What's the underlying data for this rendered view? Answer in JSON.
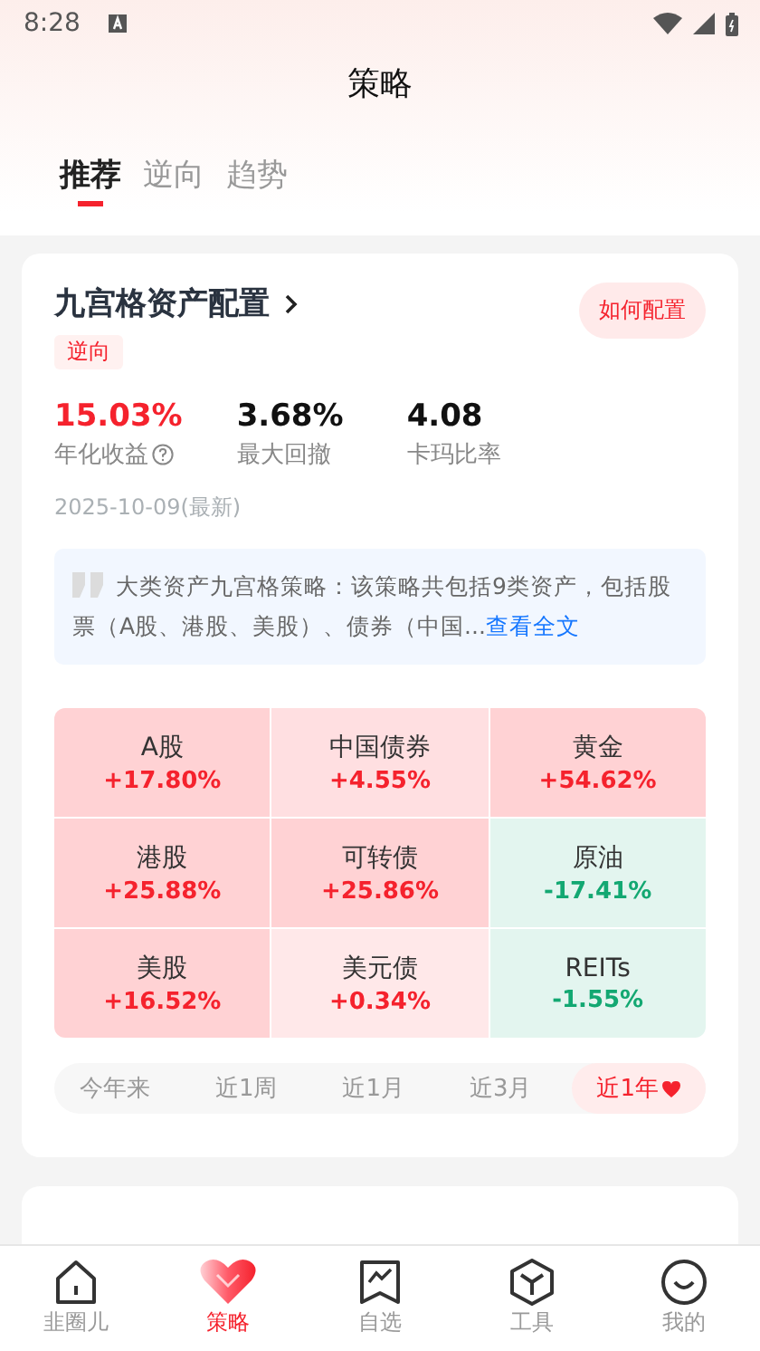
{
  "status_bar": {
    "time": "8:28"
  },
  "header": {
    "title": "策略"
  },
  "tabs": [
    {
      "label": "推荐",
      "selected": true
    },
    {
      "label": "逆向",
      "selected": false
    },
    {
      "label": "趋势",
      "selected": false
    }
  ],
  "strategy_card": {
    "title": "九宫格资产配置",
    "tag": "逆向",
    "action": "如何配置",
    "metrics": [
      {
        "value": "15.03%",
        "label": "年化收益",
        "kind": "highlight",
        "help": true
      },
      {
        "value": "3.68%",
        "label": "最大回撤",
        "kind": "normal",
        "help": false
      },
      {
        "value": "4.08",
        "label": "卡玛比率",
        "kind": "normal",
        "help": false
      }
    ],
    "date": "2025-10-09(最新)",
    "description": "大类资产九宫格策略：该策略共包括9类资产，包括股票（A股、港股、美股）、债券（中国...",
    "read_more": "查看全文",
    "grid": [
      {
        "name": "A股",
        "change": "+17.80%",
        "kind": "up",
        "color": "#ffd2d4"
      },
      {
        "name": "中国债券",
        "change": "+4.55%",
        "kind": "up",
        "color": "#ffdfe1"
      },
      {
        "name": "黄金",
        "change": "+54.62%",
        "kind": "up",
        "color": "#ffd2d4"
      },
      {
        "name": "港股",
        "change": "+25.88%",
        "kind": "up",
        "color": "#ffd2d4"
      },
      {
        "name": "可转债",
        "change": "+25.86%",
        "kind": "up",
        "color": "#ffd2d4"
      },
      {
        "name": "原油",
        "change": "-17.41%",
        "kind": "down",
        "color": "#e3f5ef"
      },
      {
        "name": "美股",
        "change": "+16.52%",
        "kind": "up",
        "color": "#ffd2d4"
      },
      {
        "name": "美元债",
        "change": "+0.34%",
        "kind": "up",
        "color": "#ffe8e9"
      },
      {
        "name": "REITs",
        "change": "-1.55%",
        "kind": "down",
        "color": "#e3f5ef"
      }
    ],
    "periods": [
      {
        "label": "今年来",
        "selected": false
      },
      {
        "label": "近1周",
        "selected": false
      },
      {
        "label": "近1月",
        "selected": false
      },
      {
        "label": "近3月",
        "selected": false
      },
      {
        "label": "近1年",
        "selected": true
      }
    ]
  },
  "bottom_nav": [
    {
      "label": "韭圈儿",
      "kind": "home",
      "selected": false
    },
    {
      "label": "策略",
      "kind": "heart",
      "selected": true
    },
    {
      "label": "自选",
      "kind": "chart",
      "selected": false
    },
    {
      "label": "工具",
      "kind": "cube",
      "selected": false
    },
    {
      "label": "我的",
      "kind": "smile",
      "selected": false
    }
  ]
}
